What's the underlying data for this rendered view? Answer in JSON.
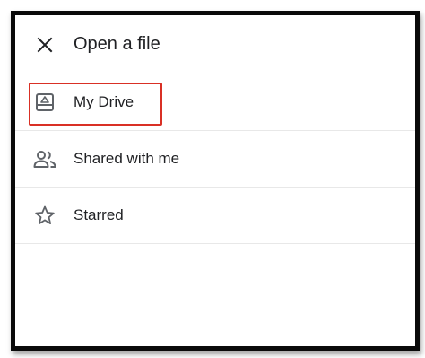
{
  "dialog": {
    "title": "Open a file",
    "close_icon": "close-icon"
  },
  "items": [
    {
      "label": "My Drive",
      "icon": "drive-icon"
    },
    {
      "label": "Shared with me",
      "icon": "people-icon"
    },
    {
      "label": "Starred",
      "icon": "star-icon"
    }
  ],
  "colors": {
    "highlight": "#d93025",
    "text": "#202124",
    "icon": "#5f6368",
    "divider": "#e8e8e8"
  }
}
